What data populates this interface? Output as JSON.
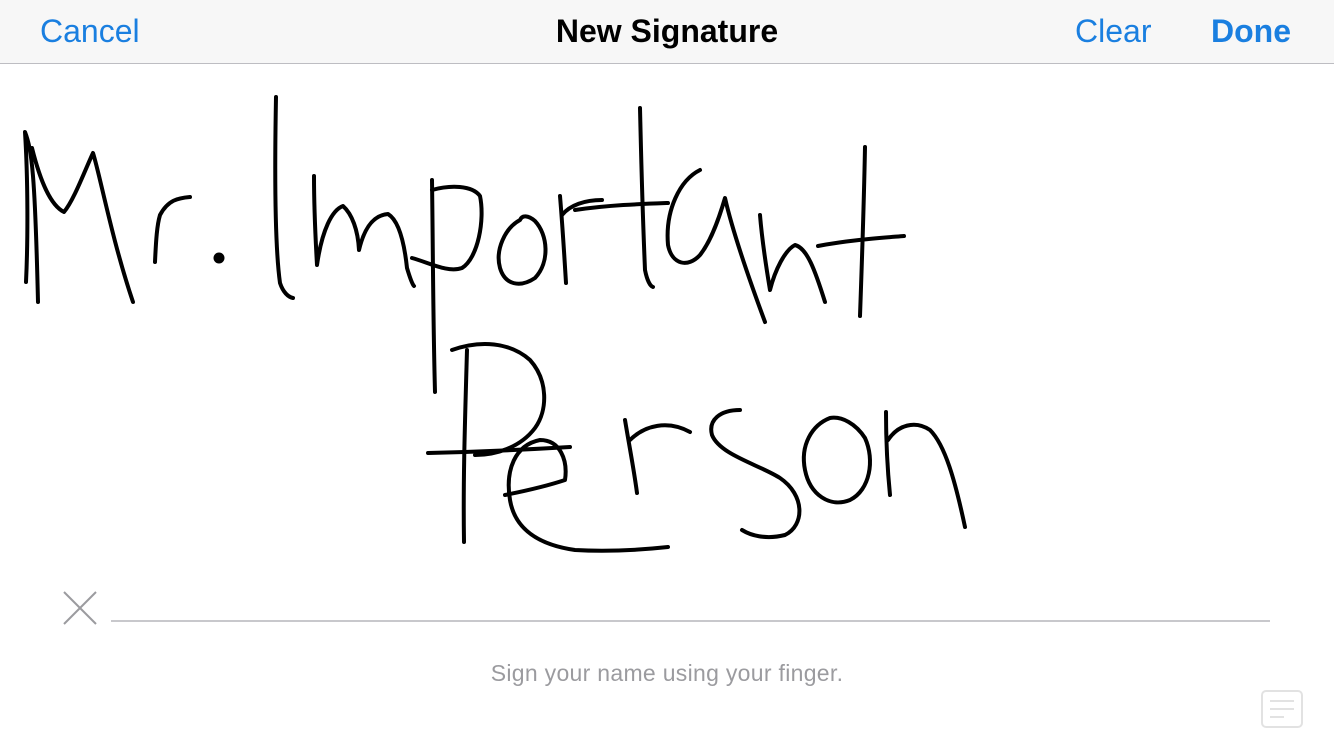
{
  "navbar": {
    "cancel_label": "Cancel",
    "title": "New Signature",
    "clear_label": "Clear",
    "done_label": "Done"
  },
  "signature_pad": {
    "signed_text": "Mr. Important Person",
    "hint": "Sign your name using your finger.",
    "x_mark_icon": "close-x-icon"
  },
  "colors": {
    "accent": "#1a7fe0",
    "ink": "#000000",
    "line": "#c8c8cc",
    "hint": "#9b9b9f"
  }
}
